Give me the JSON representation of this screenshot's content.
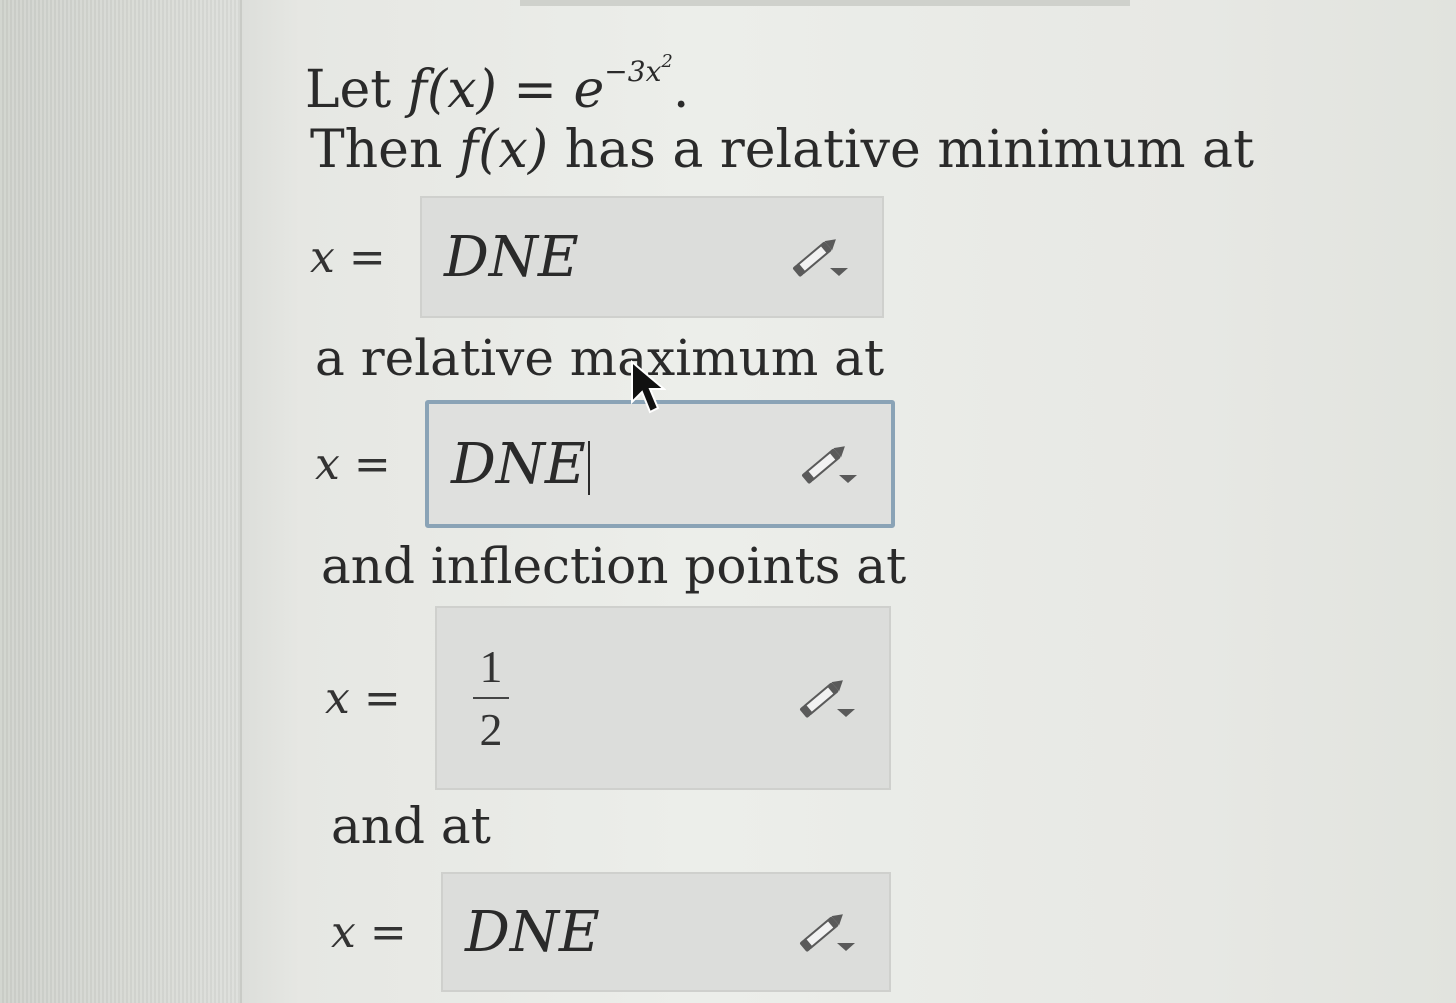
{
  "problem": {
    "line1_prefix": "Let ",
    "line1_func": "f(x) = e",
    "line1_exp": "−3x",
    "line1_exp_power": "2",
    "line1_suffix": ".",
    "line2_prefix": "Then ",
    "line2_func": "f(x)",
    "line2_suffix": " has a relative minimum at",
    "label_max": "a relative maximum at",
    "label_inflection": "and inflection points at",
    "label_and_at": "and at"
  },
  "variable_label": "x",
  "equals": "=",
  "answers": {
    "rel_min": "DNE",
    "rel_max": "DNE",
    "inflection_1_numerator": "1",
    "inflection_1_denominator": "2",
    "inflection_2": "DNE"
  },
  "icons": {
    "edit": "pencil-dropdown-icon",
    "pointer": "mouse-pointer-icon"
  },
  "colors": {
    "text": "#2a2a2a",
    "box_bg": "#dcdddb",
    "active_border": "#8aa3b6",
    "icon": "#444444"
  }
}
